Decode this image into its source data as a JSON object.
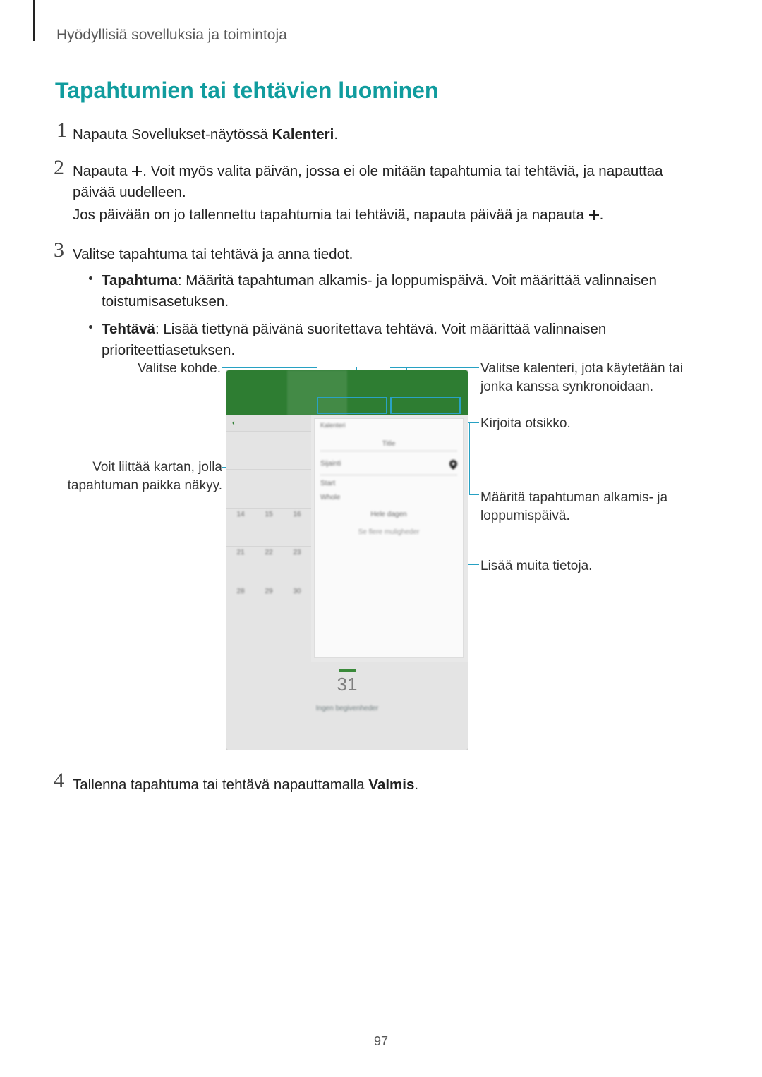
{
  "header": "Hyödyllisiä sovelluksia ja toimintoja",
  "title": "Tapahtumien tai tehtävien luominen",
  "steps": {
    "s1": {
      "pre": "Napauta Sovellukset-näytössä ",
      "bold": "Kalenteri",
      "post": "."
    },
    "s2": {
      "line1_pre": "Napauta ",
      "line1_post": ". Voit myös valita päivän, jossa ei ole mitään tapahtumia tai tehtäviä, ja napauttaa päivää uudelleen.",
      "line2_pre": "Jos päivään on jo tallennettu tapahtumia tai tehtäviä, napauta päivää ja napauta ",
      "line2_post": "."
    },
    "s3": "Valitse tapahtuma tai tehtävä ja anna tiedot.",
    "s4": {
      "pre": "Tallenna tapahtuma tai tehtävä napauttamalla ",
      "bold": "Valmis",
      "post": "."
    }
  },
  "bullets": {
    "b1_label": "Tapahtuma",
    "b1_text": ": Määritä tapahtuman alkamis- ja loppumispäivä. Voit määrittää valinnaisen toistumisasetuksen.",
    "b2_label": "Tehtävä",
    "b2_text": ": Lisää tiettynä päivänä suoritettava tehtävä. Voit määrittää valinnaisen prioriteettiasetuksen."
  },
  "callouts": {
    "c_left_1": "Valitse kohde.",
    "c_right_1": "Valitse kalenteri, jota käytetään tai jonka kanssa synkronoidaan.",
    "c_right_2": "Kirjoita otsikko.",
    "c_left_2": "Voit liittää kartan, jolla tapahtuman paikka näkyy.",
    "c_right_3": "Määritä tapahtuman alkamis- ja loppumispäivä.",
    "c_right_4": "Lisää muita tietoja."
  },
  "figure": {
    "tabs": [
      "",
      "",
      "",
      ""
    ],
    "cal_numbers": [
      [
        "",
        "",
        "",
        "",
        "",
        "",
        ""
      ],
      [
        "",
        "",
        "",
        "",
        "",
        "",
        ""
      ],
      [
        "14",
        "15",
        "16",
        "",
        "",
        "",
        ""
      ],
      [
        "21",
        "22",
        "23",
        "",
        "",
        "",
        ""
      ],
      [
        "28",
        "29",
        "30",
        "",
        "",
        "",
        ""
      ],
      [
        "",
        "",
        "",
        "",
        "",
        "",
        ""
      ]
    ],
    "panel": {
      "subtitle": "Kalenteri",
      "title_placeholder": "Title",
      "location_placeholder": "Sijainti",
      "start_label": "Start",
      "end_label": "Whole",
      "whole_label": "Hele dagen",
      "repeat_label": "Se flere muligheder"
    },
    "day_number": "31",
    "bottom_line1": "Ingen begivenheder",
    "bottom_line2": ""
  },
  "page_number": "97"
}
